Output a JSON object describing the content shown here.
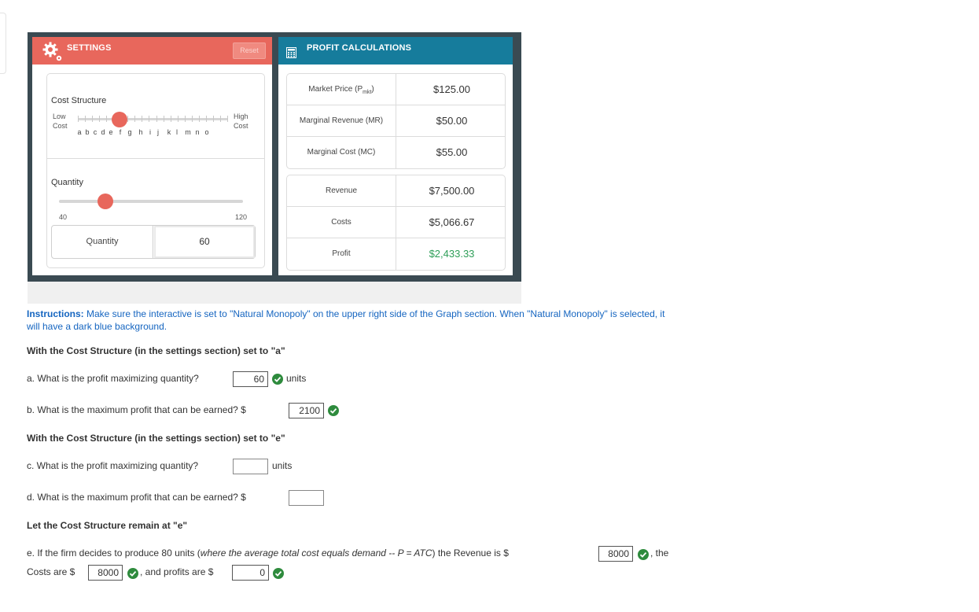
{
  "settings": {
    "title": "SETTINGS",
    "reset_label": "Reset",
    "cost_structure_label": "Cost Structure",
    "low_cost_label": [
      "Low",
      "Cost"
    ],
    "high_cost_label": [
      "High",
      "Cost"
    ],
    "cost_structure_options": [
      "a",
      "b",
      "c",
      "d",
      "e",
      "f",
      "g",
      "h",
      "i",
      "j",
      "k",
      "l",
      "m",
      "n",
      "o"
    ],
    "quantity_label": "Quantity",
    "quantity_min": "40",
    "quantity_max": "120",
    "quantity_field_label": "Quantity",
    "quantity_value": "60",
    "accent_color": "#e8675c"
  },
  "profit_calc": {
    "title": "PROFIT CALCULATIONS",
    "accent_color": "#167c9c",
    "market_price_label": "Market Price (P",
    "market_price_sub": "mkt",
    "market_price_tail": ")",
    "market_price_value": "$125.00",
    "mr_label": "Marginal Revenue (MR)",
    "mr_value": "$50.00",
    "mc_label": "Marginal Cost (MC)",
    "mc_value": "$55.00",
    "revenue_label": "Revenue",
    "revenue_value": "$7,500.00",
    "costs_label": "Costs",
    "costs_value": "$5,066.67",
    "profit_label": "Profit",
    "profit_value": "$2,433.33"
  },
  "instructions": {
    "lead": "Instructions:",
    "text": " Make sure the interactive is set to \"Natural Monopoly\" on the upper right side of the Graph section. When \"Natural Monopoly\" is selected, it will have a dark blue background."
  },
  "questions": {
    "heading_a": "With the Cost Structure (in the settings section) set to \"a\"",
    "qa": "a. What is the profit maximizing quantity?",
    "qa_answer": "60",
    "qa_unit": "units",
    "qb": "b. What is the maximum profit that can be earned? $",
    "qb_answer": "2100",
    "heading_e": "With the Cost Structure (in the settings section) set to \"e\"",
    "qc": "c. What is the profit maximizing quantity?",
    "qc_answer": "",
    "qc_unit": "units",
    "qd": "d. What is the maximum profit that can be earned? $",
    "qd_answer": "",
    "heading_remain": "Let the Cost Structure remain at \"e\"",
    "qe_start": "e. If the firm decides to produce 80 units (",
    "qe_italic": "where the average total cost equals demand -- P = ATC",
    "qe_mid": ") the Revenue is $",
    "qe_revenue": "8000",
    "qe_the": ", the",
    "qe_costs_pre": "Costs are $",
    "qe_costs": "8000",
    "qe_profits_pre": ", and profits are $",
    "qe_profits": "0"
  }
}
